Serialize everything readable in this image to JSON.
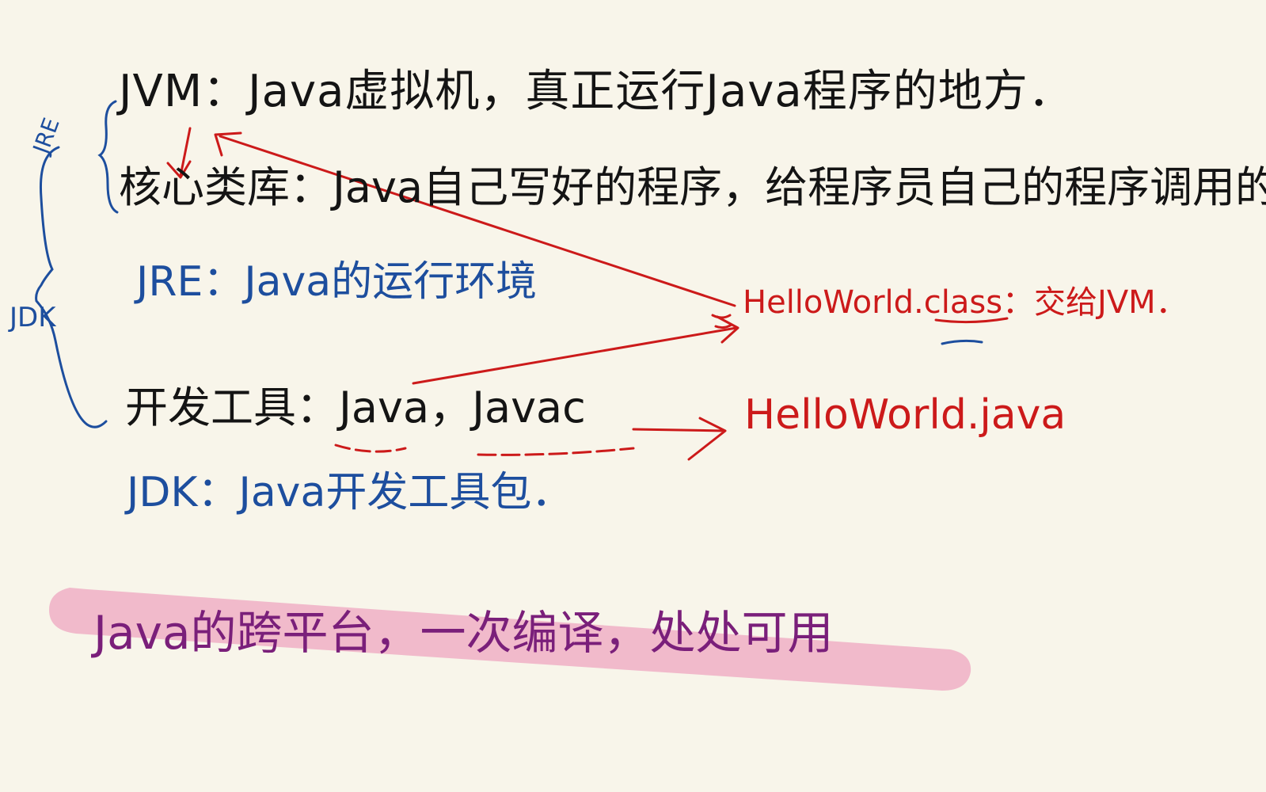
{
  "notes": {
    "jvm": "JVM：Java虚拟机，真正运行Java程序的地方．",
    "core_lib": "核心类库：Java自己写好的程序，给程序员自己的程序调用的．",
    "jre": "JRE：Java的运行环境",
    "dev_tools": "开发工具：Java，Javac",
    "jdk": "JDK：Java开发工具包．",
    "class_file": "HelloWorld.class：交给JVM．",
    "java_file": "HelloWorld.java",
    "slogan": "Java的跨平台，一次编译，处处可用"
  },
  "brace_labels": {
    "jre": "JRE",
    "jdk": "JDK"
  },
  "colors": {
    "background": "#f8f5ea",
    "black_ink": "#141414",
    "blue_ink": "#1d4e9e",
    "red_ink": "#cc1a1a",
    "purple_ink": "#7a1f7a",
    "highlighter": "#f0b4c8"
  }
}
